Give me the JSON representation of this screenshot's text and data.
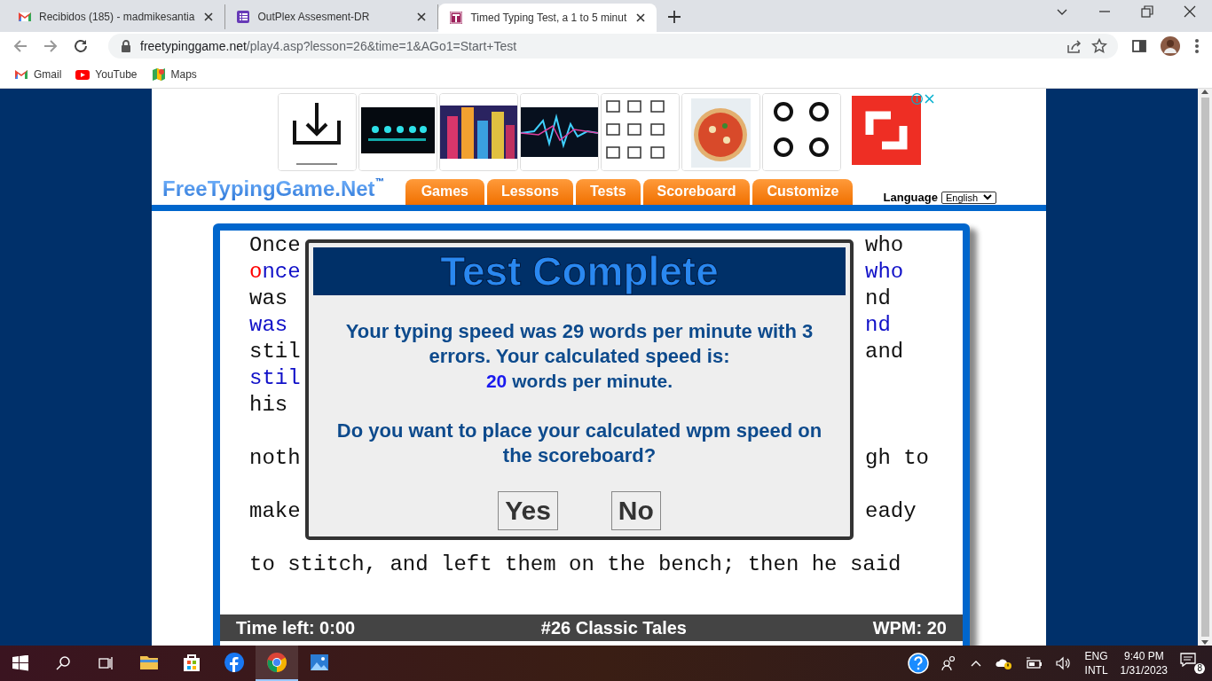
{
  "browser": {
    "tabs": [
      {
        "title": "Recibidos (185) - madmikesantia",
        "selected": false
      },
      {
        "title": "OutPlex Assesment-DR",
        "selected": false
      },
      {
        "title": "Timed Typing Test, a 1 to 5 minut",
        "selected": true
      }
    ],
    "address": {
      "domain": "freetypinggame.net",
      "path": "/play4.asp?lesson=26&time=1&AGo1=Start+Test"
    },
    "bookmarks": [
      {
        "label": "Gmail"
      },
      {
        "label": "YouTube"
      },
      {
        "label": "Maps"
      }
    ]
  },
  "page": {
    "logo": {
      "text": "FreeTypingGame.Net",
      "mark": "™"
    },
    "nav": [
      "Games",
      "Lessons",
      "Tests",
      "Scoreboard",
      "Customize"
    ],
    "language": {
      "label": "Language",
      "value": "English"
    },
    "lines": [
      {
        "kind": "source",
        "left": "Once",
        "right": "who"
      },
      {
        "kind": "typed",
        "left": [
          {
            "text": "o",
            "error": true
          },
          {
            "text": "nce",
            "error": false
          }
        ],
        "right": [
          {
            "text": "who",
            "error": false
          }
        ]
      },
      {
        "kind": "source",
        "left": "was",
        "right": "nd"
      },
      {
        "kind": "typed",
        "left": [
          {
            "text": "was",
            "error": false
          }
        ],
        "right": [
          {
            "text": "nd",
            "error": false
          }
        ]
      },
      {
        "kind": "source",
        "left": "stil",
        "right": "and"
      },
      {
        "kind": "typed",
        "left": [
          {
            "text": "stil",
            "error": false
          }
        ]
      },
      {
        "kind": "source",
        "left": "his"
      },
      {
        "kind": "blank"
      },
      {
        "kind": "source",
        "left": "noth",
        "right": "gh to"
      },
      {
        "kind": "blank"
      },
      {
        "kind": "source",
        "left": "make",
        "right": "eady"
      },
      {
        "kind": "blank"
      },
      {
        "kind": "source",
        "left": "to stitch, and left them on the bench; then he said"
      }
    ],
    "dialog": {
      "title": "Test Complete",
      "message": "Your typing speed was 29 words per minute with 3 errors. Your calculated speed is:",
      "speed": "20",
      "speed_unit": "words per minute.",
      "question": "Do you want to place your calculated wpm speed on the scoreboard?",
      "buttons": [
        "Yes",
        "No"
      ]
    },
    "status": {
      "time_left": "Time left: 0:00",
      "lesson": "#26 Classic Tales",
      "wpm": "WPM: 20"
    }
  },
  "taskbar": {
    "apps": [
      {
        "active": false
      },
      {
        "active": false
      },
      {
        "active": false
      },
      {
        "active": true
      },
      {
        "active": false
      }
    ],
    "language": [
      "ENG",
      "INTL"
    ],
    "time": "9:40 PM",
    "date": "1/31/2023",
    "notifications": "8"
  }
}
